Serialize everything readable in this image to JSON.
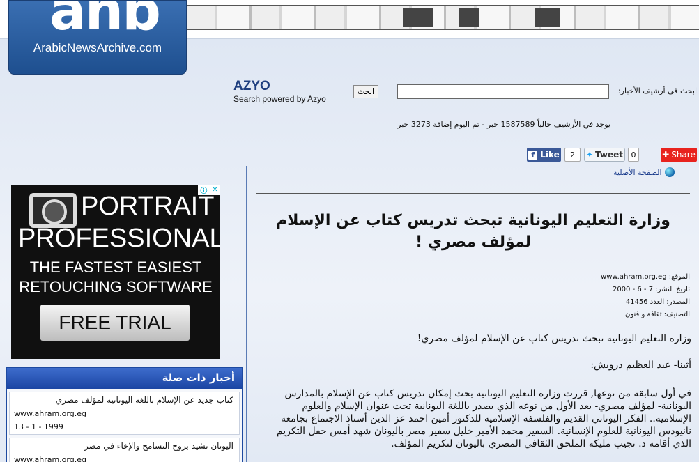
{
  "header": {
    "logo_mark": "anb",
    "logo_text": "ArabicNewsArchive.com"
  },
  "search": {
    "label": "ابحث في أرشيف الأخبار:",
    "input_value": "",
    "button_label": "ابحث",
    "provider_logo": "AZYO",
    "provider_text": "Search powered by Azyo"
  },
  "archive_info": "يوجد في الأرشيف حالياً 1587589 خبر - تم اليوم إضافة 3273 خبر",
  "social": {
    "like_label": "Like",
    "like_count": "2",
    "tweet_label": "Tweet",
    "tweet_count": "0",
    "share_label": "Share"
  },
  "original_page_link": "الصفحة الأصلية",
  "ad": {
    "line1": "PORTRAIT",
    "line2": "PROFESSIONAL",
    "line3": "THE FASTEST EASIEST",
    "line4": "RETOUCHING SOFTWARE",
    "cta": "FREE TRIAL"
  },
  "related": {
    "heading": "أخبار ذات صلة",
    "items": [
      {
        "title": "كتاب جديد عن الإسلام باللغة اليونانية لمؤلف مصري",
        "source": "www.ahram.org.eg",
        "date": "13 - 1 - 1999"
      },
      {
        "title": "اليونان تشيد بروح التسامح والإخاء في مصر",
        "source": "www.ahram.org.eg",
        "date": ""
      }
    ]
  },
  "article": {
    "title": "وزارة التعليم اليونانية تبحث تدريس كتاب عن الإسلام لمؤلف مصري !",
    "meta": {
      "site": "الموقع: www.ahram.org.eg",
      "date": "تاريخ النشر: 7 - 6 - 2000",
      "source": "المصدر: العدد 41456",
      "category": "التصنيف: ثقافة و فنون"
    },
    "lead": "وزارة التعليم اليونانية تبحث تدريس كتاب عن الإسلام لمؤلف مصري!",
    "author": "أثينا- عبد العظيم درويش:",
    "body": "في أول سابقة من نوعها, قررت وزارة التعليم اليونانية بحث إمكان تدريس كتاب عن الإسلام بالمدارس اليونانية- لمؤلف مصري- يعد الأول من نوعه الذي يصدر باللغة اليونانية تحت عنوان الإسلام والعلوم الإسلامية.. الفكر اليوناني القديم والفلسفة الإسلامية للدكتور أمين احمد عز الدين أستاذ الاجتماع بجامعة نانيودس اليونانية للعلوم الإنسانية. السفير محمد الأمير خليل سفير مصر باليونان شهد أمس حفل التكريم الذي أقامه د. نجيب مليكة الملحق الثقافي المصري باليونان لتكريم المؤلف."
  }
}
